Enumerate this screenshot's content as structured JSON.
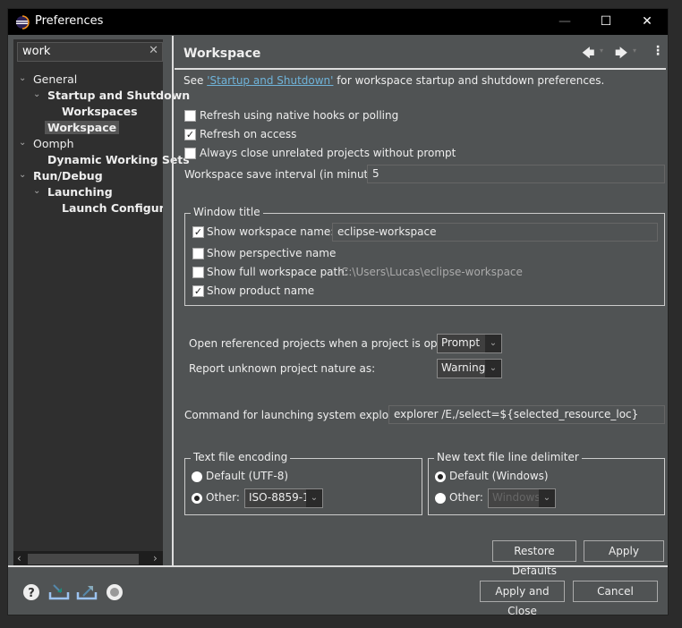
{
  "window": {
    "title": "Preferences",
    "minimize": "—",
    "maximize": "☐",
    "close": "✕"
  },
  "tree": {
    "filter_value": "work",
    "clear": "✕",
    "items": [
      {
        "label": "General",
        "level": 0,
        "expanded": true
      },
      {
        "label": "Startup and Shutdown",
        "level": 1,
        "expanded": true
      },
      {
        "label": "Workspaces",
        "level": 2
      },
      {
        "label": "Workspace",
        "level": 1,
        "selected": true
      },
      {
        "label": "Oomph",
        "level": 0,
        "expanded": true
      },
      {
        "label": "Dynamic Working Sets",
        "level": 1
      },
      {
        "label": "Run/Debug",
        "level": 0,
        "expanded": true
      },
      {
        "label": "Launching",
        "level": 1,
        "expanded": true
      },
      {
        "label": "Launch Configuration",
        "level": 2
      }
    ]
  },
  "page": {
    "title": "Workspace",
    "intro_prefix": "See ",
    "intro_link": "'Startup and Shutdown'",
    "intro_suffix": " for workspace startup and shutdown preferences.",
    "options": [
      {
        "label": "Refresh using native hooks or polling",
        "checked": false
      },
      {
        "label": "Refresh on access",
        "checked": true
      },
      {
        "label": "Always close unrelated projects without prompt",
        "checked": false
      }
    ],
    "save_interval_label": "Workspace save interval (in minutes):",
    "save_interval_value": "5",
    "window_title": {
      "label": "Window title",
      "show_workspace_name": {
        "label": "Show workspace name:",
        "checked": true,
        "value": "eclipse-workspace"
      },
      "show_perspective_name": {
        "label": "Show perspective name",
        "checked": false
      },
      "show_full_path": {
        "label": "Show full workspace path:",
        "checked": false,
        "value": "C:\\Users\\Lucas\\eclipse-workspace"
      },
      "show_product_name": {
        "label": "Show product name",
        "checked": true
      }
    },
    "open_ref_label": "Open referenced projects when a project is opened:",
    "open_ref_value": "Prompt",
    "report_label": "Report unknown project nature as:",
    "report_value": "Warning",
    "explorer_label": "Command for launching system explorer:",
    "explorer_value": "explorer /E,/select=${selected_resource_loc}",
    "encoding": {
      "label": "Text file encoding",
      "default": "Default (UTF-8)",
      "other": "Other:",
      "other_value": "ISO-8859-1",
      "selected": "other"
    },
    "delimiter": {
      "label": "New text file line delimiter",
      "default": "Default (Windows)",
      "other": "Other:",
      "other_value": "Windows",
      "selected": "default"
    },
    "restore_defaults": "Restore Defaults",
    "apply": "Apply"
  },
  "footer": {
    "apply_close": "Apply and Close",
    "cancel": "Cancel",
    "icons": [
      "help-icon",
      "import-icon",
      "export-icon",
      "oomph-record-icon"
    ]
  },
  "colors": {
    "link": "#6fb3d9",
    "background": "#505354",
    "tree_background": "#2f2f2f"
  }
}
